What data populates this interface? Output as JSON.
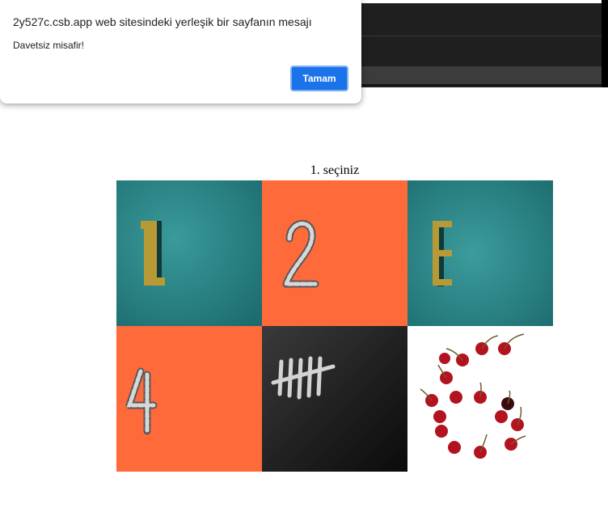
{
  "dialog": {
    "title": "2y527c.csb.app web sitesindeki yerleşik bir sayfanın mesajı",
    "message": "Davetsiz misafir!",
    "ok_label": "Tamam",
    "ok_color": "#1a73e8"
  },
  "page": {
    "heading": "1. seçiniz"
  },
  "tiles": [
    {
      "depicts": "number-1",
      "background": "#2f8b8b"
    },
    {
      "depicts": "number-2",
      "background": "#ff6b3d"
    },
    {
      "depicts": "number-3",
      "background": "#2f8b8b"
    },
    {
      "depicts": "number-4",
      "background": "#ff6b3d"
    },
    {
      "depicts": "tally-five",
      "background": "#1a1a1a"
    },
    {
      "depicts": "cherries-six",
      "background": "#ffffff"
    }
  ]
}
